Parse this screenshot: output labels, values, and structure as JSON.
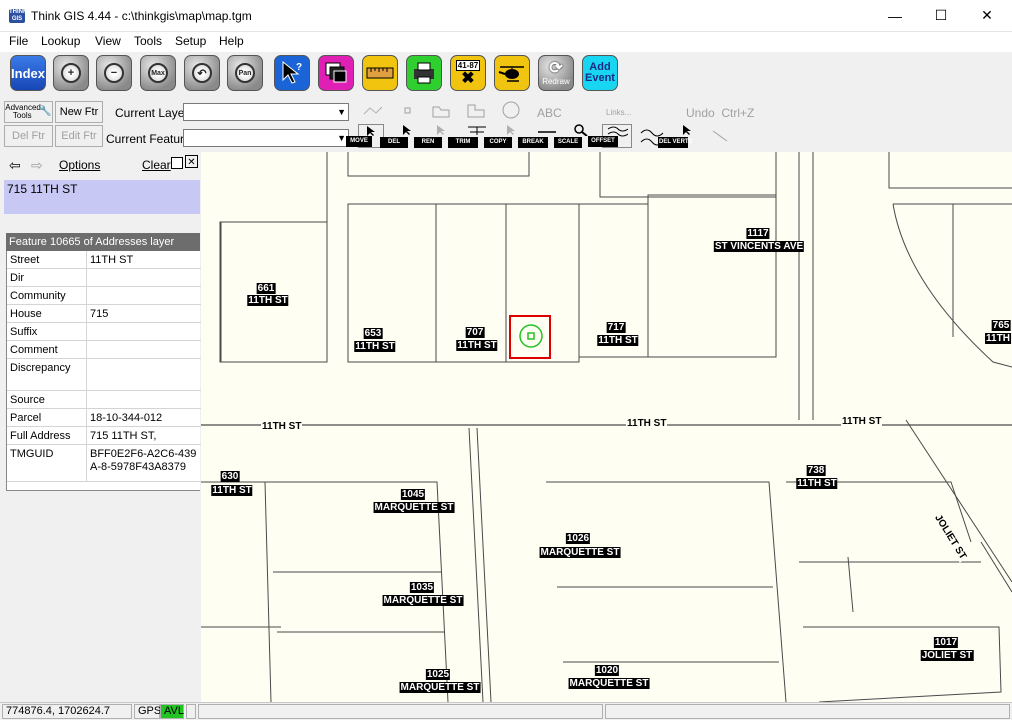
{
  "window": {
    "title": "Think GIS 4.44 - c:\\thinkgis\\map\\map.tgm",
    "icon_text": "THINK GIS",
    "minimize": "—",
    "maximize": "☐",
    "close": "✕"
  },
  "menu": [
    "File",
    "Lookup",
    "View",
    "Tools",
    "Setup",
    "Help"
  ],
  "toolbar": {
    "index_label": "Index",
    "zoom_in": "+",
    "zoom_out": "−",
    "max_label": "Max",
    "previous": "↶",
    "pan_label": "Pan",
    "calc_label": "41-87",
    "redraw_label": "Redraw",
    "add_event_label": "Add\nEvent",
    "command_value": ""
  },
  "edit_tools": {
    "advanced_tools": "Advanced Tools",
    "new_ftr": "New Ftr",
    "del_ftr": "Del Ftr",
    "edit_ftr": "Edit Ftr",
    "current_layer_label": "Current Layer",
    "current_feature_label": "Current Feature",
    "current_layer_value": "",
    "current_feature_value": "",
    "abc": "ABC",
    "links": "Links...",
    "undo": "Undo  Ctrl+Z",
    "move": "MOVE",
    "del": "DEL",
    "ren": "REN",
    "trim": "TRIM",
    "copy": "COPY",
    "break": "BREAK",
    "scale": "SCALE",
    "offset": "OFFSET",
    "del_verts": "DEL VERTS"
  },
  "left_panel": {
    "options": "Options",
    "clear": "Clear",
    "selected_address": "715 11TH ST",
    "feature_header": "Feature 10665 of Addresses layer",
    "fields": [
      {
        "key": "Street",
        "value": "11TH ST"
      },
      {
        "key": "Dir",
        "value": ""
      },
      {
        "key": "Community",
        "value": ""
      },
      {
        "key": "House",
        "value": "715"
      },
      {
        "key": "Suffix",
        "value": ""
      },
      {
        "key": "Comment",
        "value": ""
      },
      {
        "key": "Discrepancy",
        "value": ""
      },
      {
        "key": "Source",
        "value": ""
      },
      {
        "key": "Parcel",
        "value": "18-10-344-012"
      },
      {
        "key": "Full Address",
        "value": "715  11TH ST,"
      },
      {
        "key": "TMGUID",
        "value": "BFF0E2F6-A2C6-439A-8-5978F43A8379"
      }
    ]
  },
  "map": {
    "street_labels": [
      "11TH ST",
      "11TH ST",
      "11TH ST",
      "JOLIET ST"
    ],
    "parcels": [
      {
        "num": "661",
        "street": "11TH ST"
      },
      {
        "num": "653",
        "street": "11TH ST"
      },
      {
        "num": "707",
        "street": "11TH ST"
      },
      {
        "num": "717",
        "street": "11TH ST"
      },
      {
        "num": "1117",
        "street": "ST VINCENTS AVE"
      },
      {
        "num": "765",
        "street": "11TH"
      },
      {
        "num": "630",
        "street": "11TH ST"
      },
      {
        "num": "1045",
        "street": "MARQUETTE ST"
      },
      {
        "num": "1026",
        "street": "MARQUETTE ST"
      },
      {
        "num": "738",
        "street": "11TH ST"
      },
      {
        "num": "1035",
        "street": "MARQUETTE ST"
      },
      {
        "num": "1017",
        "street": "JOLIET ST"
      },
      {
        "num": "1020",
        "street": "MARQUETTE ST"
      },
      {
        "num": "1025",
        "street": "MARQUETTE ST"
      }
    ]
  },
  "status": {
    "coords": "774876.4, 1702624.7",
    "gps": "GPS",
    "avl": "AVL"
  },
  "colors": {
    "selection_box": "#e00000",
    "gps_marker": "#22c322",
    "avl_bg": "#22c322",
    "address_highlight": "#c8c8f5"
  }
}
